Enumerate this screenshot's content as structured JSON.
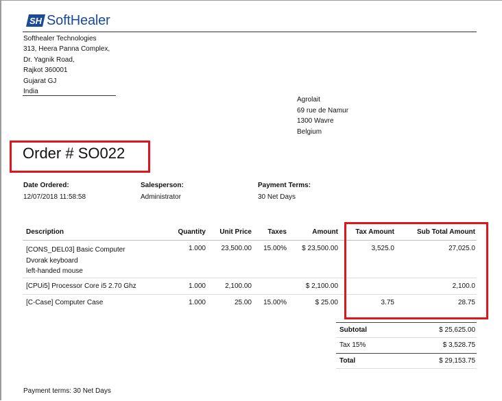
{
  "brand": {
    "name": "SoftHealer",
    "logo_mark": "SH",
    "color": "#1b4a98"
  },
  "company_address": [
    "Softhealer Technologies",
    "313, Heera Panna Complex,",
    "Dr. Yagnik Road,",
    "Rajkot 360001",
    "Gujarat GJ",
    "India"
  ],
  "customer_address": [
    "Agrolait",
    "69 rue de Namur",
    "1300 Wavre",
    "Belgium"
  ],
  "order": {
    "title": "Order # SO022"
  },
  "info": {
    "date_label": "Date Ordered:",
    "date_value": "12/07/2018 11:58:58",
    "salesperson_label": "Salesperson:",
    "salesperson_value": "Administrator",
    "terms_label": "Payment Terms:",
    "terms_value": "30 Net Days"
  },
  "table": {
    "headers": {
      "description": "Description",
      "quantity": "Quantity",
      "unit_price": "Unit Price",
      "taxes": "Taxes",
      "amount": "Amount",
      "tax_amount": "Tax Amount",
      "sub_total": "Sub Total Amount"
    },
    "rows": [
      {
        "desc": [
          "[CONS_DEL03] Basic Computer",
          "Dvorak keyboard",
          "left-handed mouse"
        ],
        "qty": "1.000",
        "unit": "23,500.00",
        "taxes": "15.00%",
        "amount": "$ 23,500.00",
        "tax_amount": "3,525.0",
        "sub_total": "27,025.0"
      },
      {
        "desc": [
          "[CPUi5] Processor Core i5 2.70 Ghz"
        ],
        "qty": "1.000",
        "unit": "2,100.00",
        "taxes": "",
        "amount": "$ 2,100.00",
        "tax_amount": "",
        "sub_total": "2,100.0"
      },
      {
        "desc": [
          "[C-Case] Computer Case"
        ],
        "qty": "1.000",
        "unit": "25.00",
        "taxes": "15.00%",
        "amount": "$ 25.00",
        "tax_amount": "3.75",
        "sub_total": "28.75"
      }
    ]
  },
  "totals": {
    "subtotal_label": "Subtotal",
    "subtotal_value": "$ 25,625.00",
    "tax_label": "Tax 15%",
    "tax_value": "$ 3,528.75",
    "total_label": "Total",
    "total_value": "$ 29,153.75"
  },
  "footer": {
    "payment_terms": "Payment terms: 30 Net Days"
  },
  "highlight_color": "#e0141c"
}
